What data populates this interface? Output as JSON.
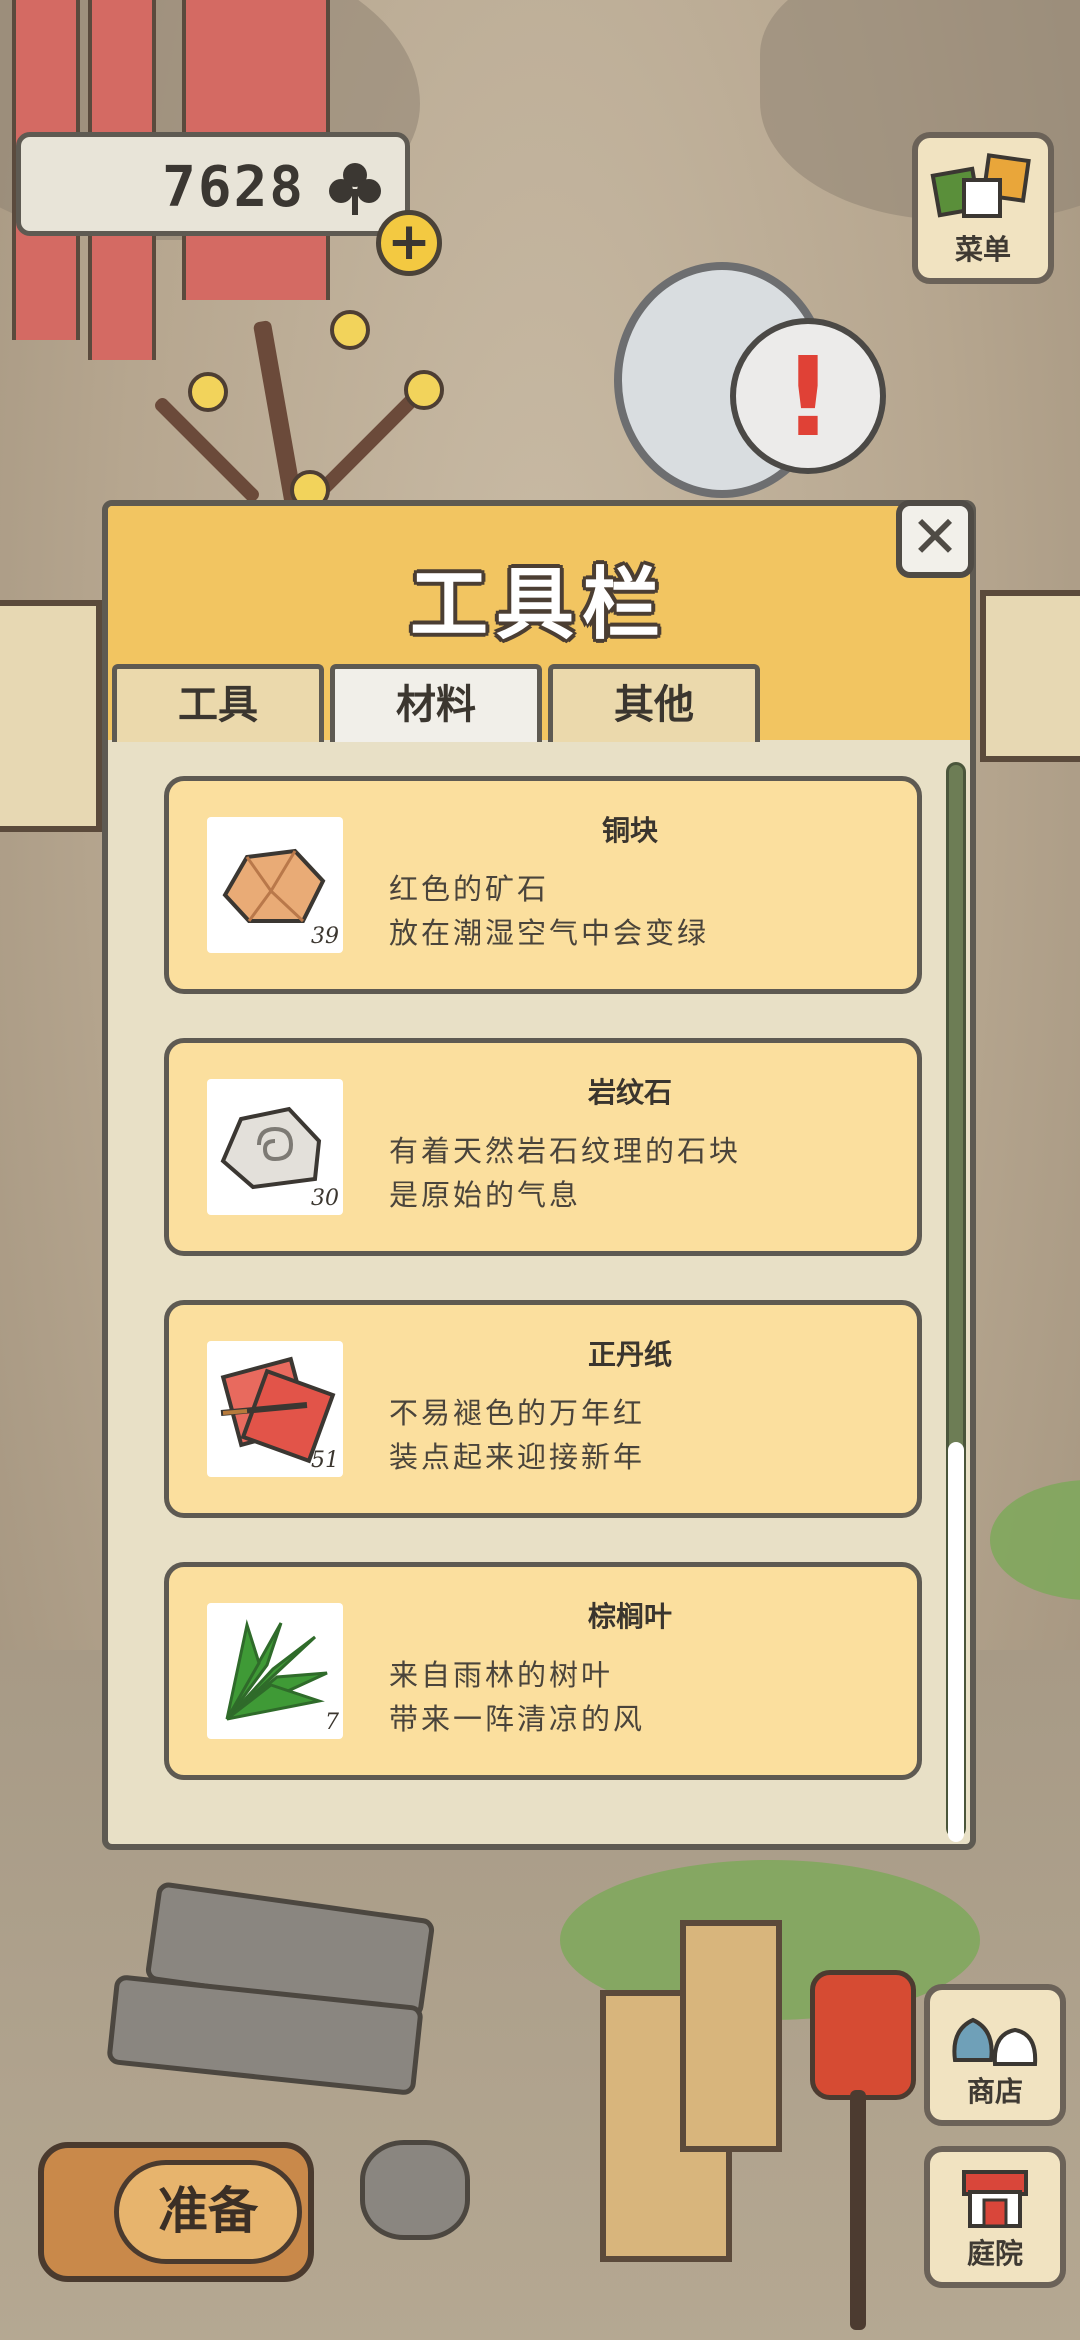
{
  "hud": {
    "clover_count": "7628",
    "plus_label": "+",
    "menu_label": "菜单",
    "shop_label": "商店",
    "yard_label": "庭院",
    "prepare_label": "准备",
    "alert_label": "!"
  },
  "toolbox": {
    "title": "工具栏",
    "close_label": "✕",
    "tabs": [
      {
        "label": "工具"
      },
      {
        "label": "材料"
      },
      {
        "label": "其他"
      }
    ],
    "active_tab": "材料",
    "items": [
      {
        "name": "铜块",
        "desc1": "红色的矿石",
        "desc2": "放在潮湿空气中会变绿",
        "count": "39",
        "icon": "copper-ore-icon"
      },
      {
        "name": "岩纹石",
        "desc1": "有着天然岩石纹理的石块",
        "desc2": "是原始的气息",
        "count": "30",
        "icon": "patterned-stone-icon"
      },
      {
        "name": "正丹纸",
        "desc1": "不易褪色的万年红",
        "desc2": "装点起来迎接新年",
        "count": "51",
        "icon": "red-paper-icon"
      },
      {
        "name": "棕榈叶",
        "desc1": "来自雨林的树叶",
        "desc2": "带来一阵清凉的风",
        "count": "7",
        "icon": "palm-leaf-icon"
      }
    ]
  },
  "colors": {
    "panel_header": "#f2c561",
    "item_bg": "#fbdf9e",
    "scrollbar": "#6d7d55",
    "alert_red": "#e04136"
  }
}
